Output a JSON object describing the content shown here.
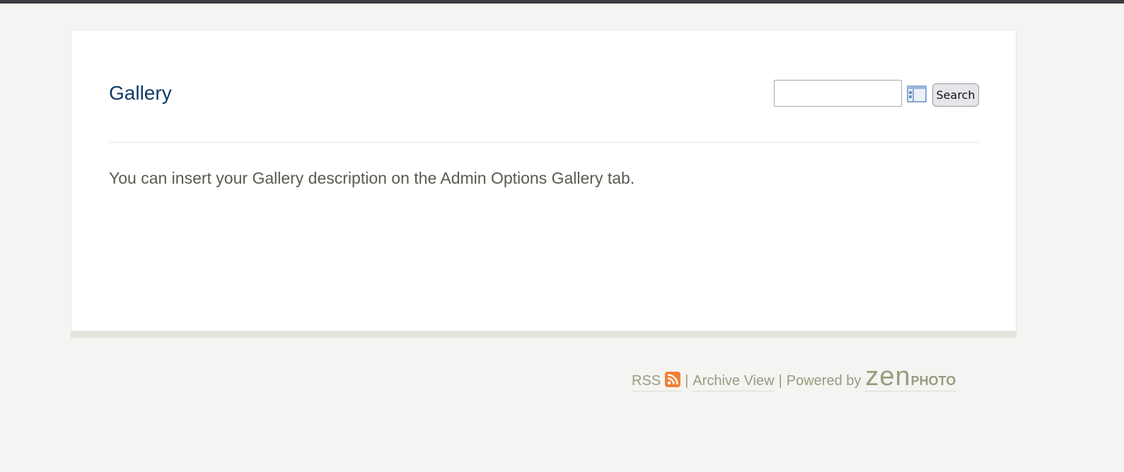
{
  "header": {
    "title": "Gallery"
  },
  "search": {
    "value": "",
    "placeholder": "",
    "button_label": "Search",
    "fields_icon": "search-fields-icon"
  },
  "content": {
    "description": "You can insert your Gallery description on the Admin Options Gallery tab."
  },
  "footer": {
    "rss_label": "RSS",
    "rss_icon": "rss-feed-icon",
    "separator": "|",
    "archive_label": "Archive View",
    "powered_by": "Powered by",
    "logo_zen": "zen",
    "logo_photo": "PHOTO"
  },
  "colors": {
    "title": "#0e3b6b",
    "text": "#5b5b4e",
    "footer_text": "#9a9a7f",
    "rss_orange": "#f47f34",
    "background": "#f4f4f2"
  }
}
